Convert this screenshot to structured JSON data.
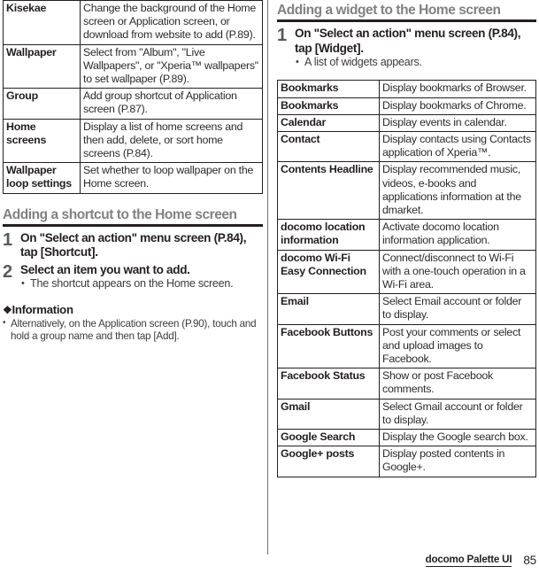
{
  "footer": {
    "section_label": "docomo Palette UI",
    "page_number": "85"
  },
  "left_column": {
    "top_table": {
      "rows": [
        {
          "name": "Kisekae",
          "description": "Change the background of the Home screen or Application screen, or download from website to add (P.89)."
        },
        {
          "name": "Wallpaper",
          "description": "Select from \"Album\", \"Live Wallpapers\", or \"Xperia™ wallpapers\" to set wallpaper (P.89)."
        },
        {
          "name": "Group",
          "description": "Add group shortcut of Application screen (P.87)."
        },
        {
          "name": "Home screens",
          "description": "Display a list of home screens and then add, delete, or sort home screens (P.84)."
        },
        {
          "name": "Wallpaper loop settings",
          "description": "Set whether to loop wallpaper on the Home screen."
        }
      ]
    },
    "section": {
      "heading": "Adding a shortcut to the Home screen",
      "steps": [
        {
          "number": "1",
          "text": "On \"Select an action\" menu screen (P.84), tap [Shortcut].",
          "bullets": []
        },
        {
          "number": "2",
          "text": "Select an item you want to add.",
          "bullets": [
            "The shortcut appears on the Home screen."
          ]
        }
      ],
      "information": {
        "glyph": "❖",
        "title": "Information",
        "items": [
          "Alternatively, on the Application screen (P.90), touch and hold a group name and then tap [Add]."
        ]
      }
    }
  },
  "right_column": {
    "section": {
      "heading": "Adding a widget to the Home screen",
      "steps": [
        {
          "number": "1",
          "text": "On \"Select an action\" menu screen (P.84), tap [Widget].",
          "bullets": [
            "A list of widgets appears."
          ]
        }
      ]
    },
    "widget_table": {
      "rows": [
        {
          "name": "Bookmarks",
          "description": "Display bookmarks of Browser."
        },
        {
          "name": "Bookmarks",
          "description": "Display bookmarks of Chrome."
        },
        {
          "name": "Calendar",
          "description": "Display events in calendar."
        },
        {
          "name": "Contact",
          "description": "Display contacts using Contacts application of Xperia™."
        },
        {
          "name": "Contents Headline",
          "description": "Display recommended music, videos, e-books and applications information at the dmarket."
        },
        {
          "name": "docomo location information",
          "description": "Activate docomo location information application."
        },
        {
          "name": "docomo Wi-Fi Easy Connection",
          "description": "Connect/disconnect to Wi-Fi with a one-touch operation in a Wi-Fi area."
        },
        {
          "name": "Email",
          "description": "Select Email account or folder to display."
        },
        {
          "name": "Facebook Buttons",
          "description": "Post your comments or select and upload images to Facebook."
        },
        {
          "name": "Facebook Status",
          "description": "Show or post Facebook comments."
        },
        {
          "name": "Gmail",
          "description": "Select Gmail account or folder to display."
        },
        {
          "name": "Google Search",
          "description": "Display the Google search box."
        },
        {
          "name": "Google+ posts",
          "description": "Display posted contents in Google+."
        }
      ]
    }
  }
}
